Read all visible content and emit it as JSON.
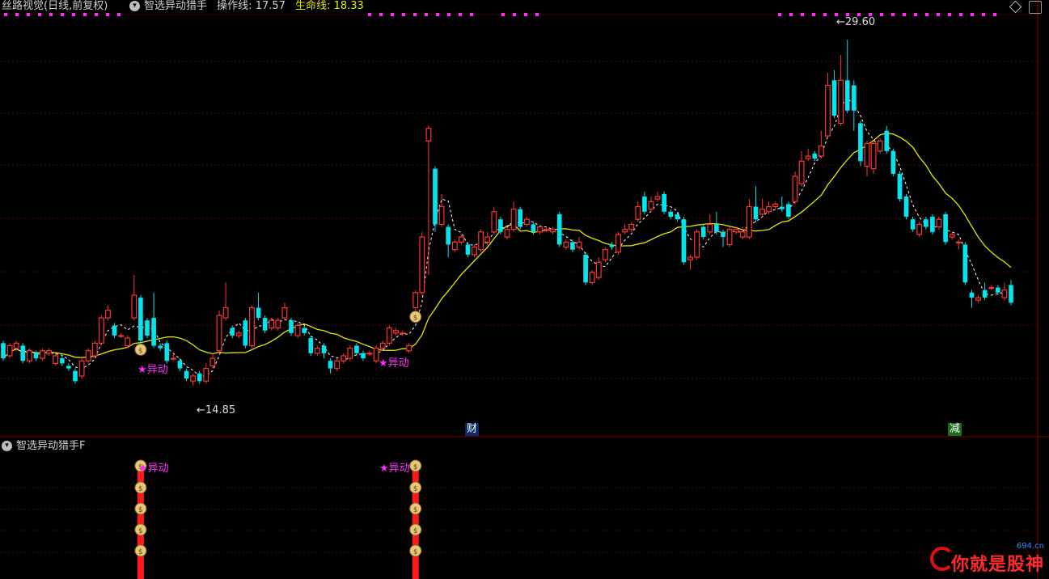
{
  "header": {
    "title": "丝路视觉(日线,前复权)",
    "indicator_name": "智选异动猎手",
    "op_label": "操作线",
    "op_value": "17.57",
    "life_label": "生命线",
    "life_value": "18.33"
  },
  "sub_panel": {
    "title": "智选异动猎手F"
  },
  "signals": {
    "label": "★异动"
  },
  "price_labels": {
    "high": "29.60",
    "low": "14.85"
  },
  "tags": {
    "cai": "财",
    "jian": "减"
  },
  "watermark": {
    "text": "你就是股神",
    "sub": "694.cn"
  },
  "colors": {
    "up": "#ff3333",
    "down": "#00e5ee",
    "life_line": "#e6e600",
    "op_line": "#ffffff",
    "signal": "#ff2bff",
    "grid": "#5a0000"
  },
  "chart_data": {
    "type": "candlestick",
    "ylim": [
      13.9,
      30.6
    ],
    "candles": [
      [
        17.6,
        17.0,
        17.7,
        16.9
      ],
      [
        17.1,
        17.5,
        17.6,
        17.0
      ],
      [
        17.4,
        17.6,
        17.7,
        17.3
      ],
      [
        17.5,
        16.9,
        17.6,
        16.8
      ],
      [
        16.9,
        17.3,
        17.4,
        16.8
      ],
      [
        17.2,
        17.0,
        17.3,
        16.9
      ],
      [
        17.0,
        17.3,
        17.4,
        16.9
      ],
      [
        17.2,
        17.3,
        17.4,
        17.1
      ],
      [
        16.8,
        17.1,
        17.2,
        16.7
      ],
      [
        17.0,
        16.8,
        17.1,
        16.7
      ],
      [
        16.7,
        16.6,
        16.8,
        16.5
      ],
      [
        16.5,
        16.1,
        16.6,
        16.0
      ],
      [
        16.3,
        16.9,
        17.0,
        16.2
      ],
      [
        16.9,
        17.3,
        17.4,
        16.8
      ],
      [
        17.1,
        17.6,
        17.7,
        17.0
      ],
      [
        17.6,
        18.6,
        18.7,
        17.5
      ],
      [
        18.6,
        18.9,
        19.1,
        18.5
      ],
      [
        18.3,
        17.9,
        18.4,
        17.8
      ],
      [
        17.9,
        17.9,
        18.0,
        17.8
      ],
      [
        17.5,
        17.8,
        17.9,
        17.4
      ],
      [
        18.6,
        19.5,
        20.3,
        18.5
      ],
      [
        19.4,
        17.7,
        19.5,
        17.6
      ],
      [
        18.5,
        17.9,
        18.6,
        17.8
      ],
      [
        18.6,
        17.5,
        19.6,
        17.4
      ],
      [
        17.5,
        17.4,
        17.6,
        17.3
      ],
      [
        17.6,
        16.9,
        17.7,
        16.8
      ],
      [
        17.0,
        17.0,
        17.2,
        16.9
      ],
      [
        16.9,
        16.6,
        17.0,
        16.5
      ],
      [
        16.5,
        16.2,
        16.6,
        16.1
      ],
      [
        16.1,
        16.3,
        16.4,
        15.9
      ],
      [
        16.4,
        16.1,
        16.5,
        16.0
      ],
      [
        16.1,
        16.6,
        16.8,
        16.0
      ],
      [
        16.7,
        17.0,
        17.2,
        16.6
      ],
      [
        17.3,
        18.7,
        18.9,
        17.2
      ],
      [
        18.6,
        19.0,
        20.0,
        18.5
      ],
      [
        18.2,
        17.9,
        18.3,
        17.8
      ],
      [
        17.9,
        18.0,
        18.1,
        17.8
      ],
      [
        18.5,
        17.5,
        18.6,
        17.4
      ],
      [
        17.5,
        19.0,
        19.1,
        17.4
      ],
      [
        19.0,
        18.6,
        19.6,
        18.5
      ],
      [
        18.6,
        18.1,
        18.7,
        18.0
      ],
      [
        18.2,
        18.5,
        18.6,
        18.1
      ],
      [
        18.2,
        18.5,
        18.6,
        18.1
      ],
      [
        18.6,
        19.0,
        19.2,
        18.5
      ],
      [
        18.5,
        18.0,
        18.6,
        17.9
      ],
      [
        17.9,
        18.3,
        18.4,
        17.8
      ],
      [
        18.2,
        18.0,
        18.3,
        17.9
      ],
      [
        17.8,
        17.2,
        17.9,
        17.1
      ],
      [
        17.2,
        17.4,
        17.5,
        17.1
      ],
      [
        17.5,
        17.2,
        17.6,
        17.0
      ],
      [
        16.9,
        16.6,
        17.0,
        16.4
      ],
      [
        16.6,
        16.9,
        17.0,
        16.5
      ],
      [
        16.9,
        17.1,
        17.2,
        16.8
      ],
      [
        17.0,
        17.4,
        17.5,
        16.9
      ],
      [
        17.5,
        17.2,
        17.6,
        17.1
      ],
      [
        17.2,
        17.0,
        17.3,
        16.9
      ],
      [
        17.2,
        17.2,
        17.3,
        17.1
      ],
      [
        16.9,
        17.4,
        17.5,
        16.8
      ],
      [
        17.4,
        17.6,
        17.7,
        17.3
      ],
      [
        17.6,
        18.2,
        18.3,
        17.5
      ],
      [
        18.0,
        18.1,
        18.2,
        17.9
      ],
      [
        18.0,
        18.0,
        18.1,
        17.9
      ],
      [
        17.3,
        17.5,
        17.6,
        17.2
      ],
      [
        19.0,
        19.6,
        19.7,
        18.9
      ],
      [
        19.6,
        21.8,
        22.0,
        19.5
      ],
      [
        25.6,
        26.1,
        26.2,
        20.3
      ],
      [
        24.5,
        22.3,
        24.6,
        22.0
      ],
      [
        22.3,
        23.0,
        23.5,
        22.2
      ],
      [
        22.2,
        21.5,
        22.3,
        21.0
      ],
      [
        21.3,
        21.6,
        21.7,
        21.2
      ],
      [
        21.6,
        21.8,
        21.9,
        21.5
      ],
      [
        21.5,
        21.1,
        21.6,
        21.0
      ],
      [
        21.1,
        21.4,
        21.5,
        21.0
      ],
      [
        21.3,
        22.0,
        22.1,
        21.2
      ],
      [
        21.6,
        21.8,
        22.0,
        21.5
      ],
      [
        22.0,
        22.8,
        23.0,
        21.9
      ],
      [
        22.5,
        22.0,
        22.6,
        21.9
      ],
      [
        21.8,
        22.1,
        22.2,
        21.7
      ],
      [
        22.1,
        22.9,
        23.2,
        22.0
      ],
      [
        22.9,
        22.2,
        23.0,
        22.1
      ],
      [
        22.3,
        22.5,
        22.6,
        22.2
      ],
      [
        22.3,
        22.0,
        22.4,
        21.9
      ],
      [
        22.0,
        22.2,
        22.3,
        21.9
      ],
      [
        22.1,
        22.1,
        22.2,
        22.0
      ],
      [
        22.0,
        22.1,
        22.2,
        21.9
      ],
      [
        22.7,
        21.5,
        22.8,
        21.4
      ],
      [
        21.4,
        21.6,
        21.7,
        21.3
      ],
      [
        21.6,
        21.3,
        21.7,
        21.2
      ],
      [
        21.4,
        21.6,
        21.8,
        21.3
      ],
      [
        21.1,
        20.0,
        21.2,
        19.9
      ],
      [
        20.0,
        20.4,
        20.5,
        19.9
      ],
      [
        20.2,
        20.8,
        21.0,
        20.1
      ],
      [
        20.9,
        21.3,
        21.4,
        20.8
      ],
      [
        21.5,
        21.4,
        21.6,
        21.3
      ],
      [
        21.2,
        21.9,
        22.0,
        21.1
      ],
      [
        22.0,
        22.1,
        22.3,
        21.9
      ],
      [
        22.1,
        22.3,
        22.4,
        22.0
      ],
      [
        22.5,
        23.0,
        23.2,
        22.4
      ],
      [
        23.4,
        22.8,
        23.6,
        22.7
      ],
      [
        22.9,
        23.2,
        23.4,
        22.8
      ],
      [
        23.3,
        23.4,
        23.6,
        23.2
      ],
      [
        23.5,
        22.8,
        23.6,
        22.7
      ],
      [
        22.8,
        22.6,
        22.9,
        22.5
      ],
      [
        22.7,
        22.5,
        22.8,
        22.4
      ],
      [
        22.5,
        20.8,
        22.6,
        20.7
      ],
      [
        20.9,
        21.0,
        21.1,
        20.5
      ],
      [
        21.0,
        22.0,
        22.1,
        20.9
      ],
      [
        22.2,
        21.8,
        22.3,
        21.7
      ],
      [
        22.0,
        22.3,
        22.7,
        21.9
      ],
      [
        22.3,
        22.0,
        22.8,
        21.9
      ],
      [
        22.0,
        21.8,
        22.1,
        21.4
      ],
      [
        21.5,
        22.1,
        22.2,
        21.4
      ],
      [
        22.0,
        22.1,
        22.2,
        21.9
      ],
      [
        21.8,
        22.0,
        22.2,
        21.7
      ],
      [
        21.8,
        23.0,
        23.3,
        21.7
      ],
      [
        23.0,
        22.5,
        23.8,
        22.4
      ],
      [
        22.7,
        22.9,
        23.3,
        22.6
      ],
      [
        22.8,
        23.0,
        23.2,
        22.7
      ],
      [
        23.0,
        23.1,
        23.2,
        22.9
      ],
      [
        23.0,
        22.9,
        23.4,
        22.8
      ],
      [
        23.1,
        22.6,
        23.2,
        22.5
      ],
      [
        23.2,
        24.2,
        24.4,
        23.1
      ],
      [
        23.9,
        24.8,
        25.2,
        23.8
      ],
      [
        24.9,
        25.0,
        25.3,
        24.8
      ],
      [
        25.1,
        24.9,
        25.2,
        24.8
      ],
      [
        25.0,
        25.4,
        26.0,
        24.9
      ],
      [
        25.8,
        27.8,
        28.3,
        25.7
      ],
      [
        28.0,
        26.6,
        28.4,
        26.5
      ],
      [
        26.3,
        28.0,
        29.0,
        26.2
      ],
      [
        28.0,
        26.8,
        29.6,
        26.7
      ],
      [
        27.8,
        26.8,
        28.0,
        26.0
      ],
      [
        26.3,
        24.8,
        26.4,
        24.6
      ],
      [
        24.6,
        25.5,
        25.6,
        24.2
      ],
      [
        24.5,
        25.5,
        25.6,
        24.3
      ],
      [
        25.2,
        25.6,
        25.7,
        25.1
      ],
      [
        26.0,
        25.2,
        26.2,
        25.1
      ],
      [
        25.2,
        24.3,
        25.3,
        24.2
      ],
      [
        24.3,
        23.3,
        24.4,
        23.2
      ],
      [
        23.4,
        22.6,
        23.5,
        22.5
      ],
      [
        22.5,
        22.1,
        22.6,
        22.0
      ],
      [
        21.9,
        22.3,
        22.4,
        21.8
      ],
      [
        22.5,
        22.2,
        22.6,
        22.1
      ],
      [
        22.6,
        22.0,
        22.7,
        21.9
      ],
      [
        22.2,
        22.5,
        22.6,
        22.1
      ],
      [
        22.7,
        21.6,
        22.8,
        21.5
      ],
      [
        21.8,
        21.9,
        22.0,
        21.7
      ],
      [
        21.6,
        21.6,
        21.7,
        21.3
      ],
      [
        21.5,
        20.0,
        21.6,
        19.9
      ],
      [
        19.6,
        19.4,
        19.7,
        19.0
      ],
      [
        19.3,
        19.4,
        19.5,
        19.2
      ],
      [
        19.7,
        19.4,
        20.0,
        19.3
      ],
      [
        19.8,
        19.8,
        19.9,
        19.7
      ],
      [
        19.8,
        19.6,
        19.9,
        19.5
      ],
      [
        19.4,
        19.7,
        20.0,
        19.3
      ],
      [
        19.9,
        19.2,
        20.1,
        19.1
      ]
    ],
    "signal_indices": [
      21,
      63
    ]
  }
}
